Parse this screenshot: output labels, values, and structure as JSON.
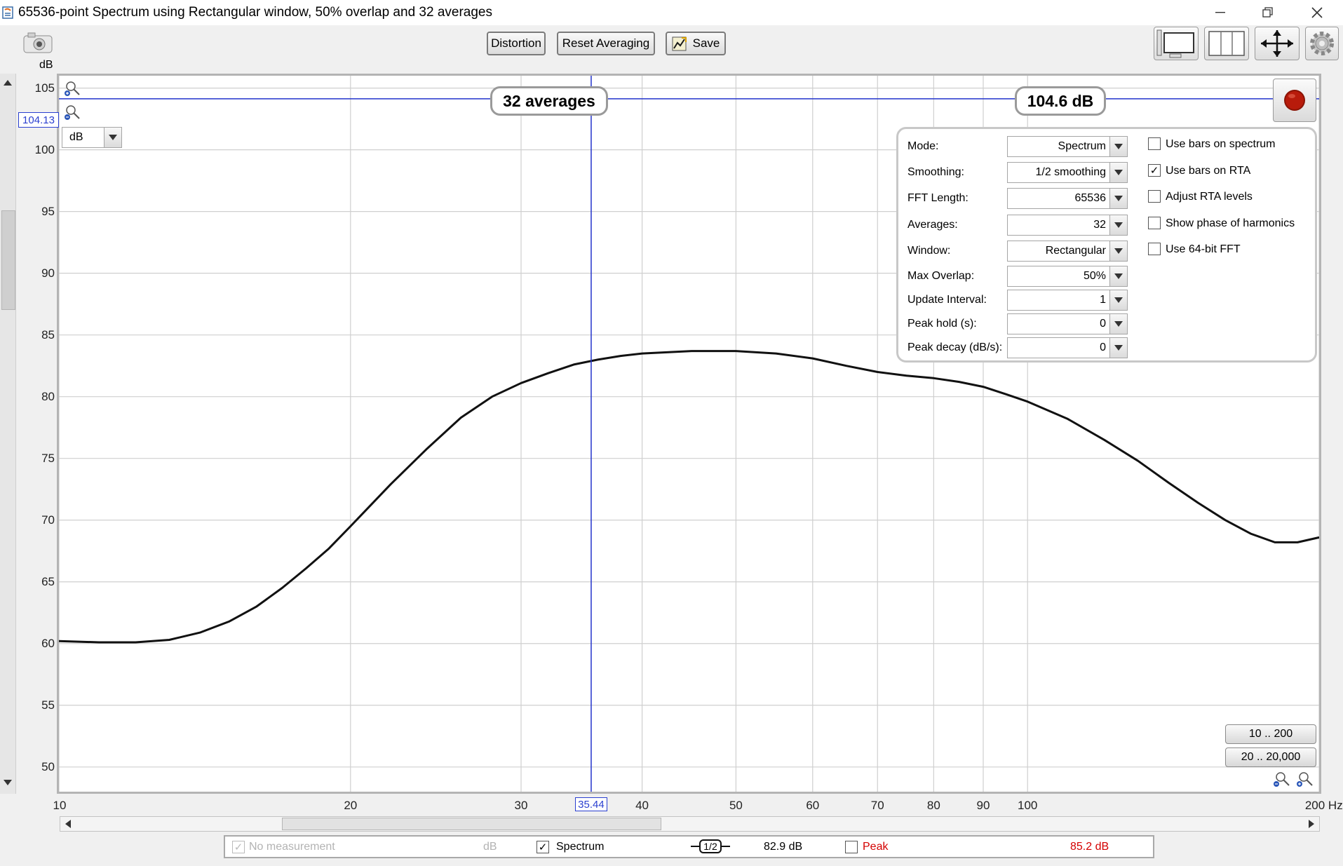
{
  "window": {
    "title": "65536-point Spectrum using Rectangular window, 50% overlap and 32 averages"
  },
  "toolbar": {
    "distortion_label": "Distortion",
    "reset_label": "Reset Averaging",
    "save_label": "Save"
  },
  "axis": {
    "y_unit": "dB",
    "x_unit": "Hz",
    "cursor_y_readout": "104.13",
    "cursor_x_readout": "35.44",
    "unit_select": "dB"
  },
  "overlay": {
    "averages_badge": "32 averages",
    "level_badge": "104.6 dB"
  },
  "settings": {
    "rows": [
      {
        "label": "Mode:",
        "value": "Spectrum"
      },
      {
        "label": "Smoothing:",
        "value": "1/2 smoothing"
      },
      {
        "label": "FFT Length:",
        "value": "65536"
      },
      {
        "label": "Averages:",
        "value": "32"
      },
      {
        "label": "Window:",
        "value": "Rectangular"
      },
      {
        "label": "Max Overlap:",
        "value": "50%"
      },
      {
        "label": "Update Interval:",
        "value": "1"
      },
      {
        "label": "Peak hold (s):",
        "value": "0"
      },
      {
        "label": "Peak decay (dB/s):",
        "value": "0"
      }
    ],
    "checks": [
      {
        "label": "Use bars on spectrum",
        "checked": false
      },
      {
        "label": "Use bars on RTA",
        "checked": true
      },
      {
        "label": "Adjust RTA levels",
        "checked": false
      },
      {
        "label": "Show phase of harmonics",
        "checked": false
      },
      {
        "label": "Use 64-bit FFT",
        "checked": false
      }
    ]
  },
  "range_buttons": {
    "narrow": "10 .. 200",
    "wide": "20 .. 20,000"
  },
  "status": {
    "measurement_label": "No measurement",
    "measurement_unit": "dB",
    "spectrum_label": "Spectrum",
    "smoothing_tag": "1/2",
    "spectrum_value": "82.9 dB",
    "peak_label": "Peak",
    "peak_value": "85.2 dB"
  },
  "chart_data": {
    "type": "line",
    "xscale": "log",
    "xlim": [
      10,
      200
    ],
    "ylim": [
      48,
      106
    ],
    "x_ticks": [
      10,
      20,
      30,
      40,
      50,
      60,
      70,
      80,
      90,
      100,
      200
    ],
    "x_tick_labels": [
      "10",
      "20",
      "30",
      "40",
      "50",
      "60",
      "70",
      "80",
      "90",
      "100",
      "200 Hz"
    ],
    "y_ticks": [
      50,
      55,
      60,
      65,
      70,
      75,
      80,
      85,
      90,
      95,
      100,
      105
    ],
    "y_tick_labels": [
      "50",
      "55",
      "60",
      "65",
      "70",
      "75",
      "80",
      "85",
      "90",
      "95",
      "100",
      "105"
    ],
    "ylabel": "dB",
    "grid": true,
    "cursor": {
      "x": 35.44,
      "y": 104.13
    },
    "series": [
      {
        "color": "#111111",
        "x": [
          10,
          11,
          12,
          13,
          14,
          15,
          16,
          17,
          18,
          19,
          20,
          22,
          24,
          26,
          28,
          30,
          32,
          34,
          36,
          38,
          40,
          45,
          50,
          55,
          60,
          65,
          70,
          75,
          80,
          85,
          90,
          95,
          100,
          110,
          120,
          130,
          140,
          150,
          160,
          170,
          180,
          190,
          200
        ],
        "y": [
          60.2,
          60.1,
          60.1,
          60.3,
          60.9,
          61.8,
          63.0,
          64.5,
          66.1,
          67.7,
          69.5,
          72.9,
          75.8,
          78.3,
          80.0,
          81.1,
          81.9,
          82.6,
          83.0,
          83.3,
          83.5,
          83.7,
          83.7,
          83.5,
          83.1,
          82.5,
          82.0,
          81.7,
          81.5,
          81.2,
          80.8,
          80.2,
          79.6,
          78.2,
          76.5,
          74.8,
          73.0,
          71.4,
          70.0,
          68.9,
          68.2,
          68.2,
          68.6
        ]
      }
    ]
  }
}
